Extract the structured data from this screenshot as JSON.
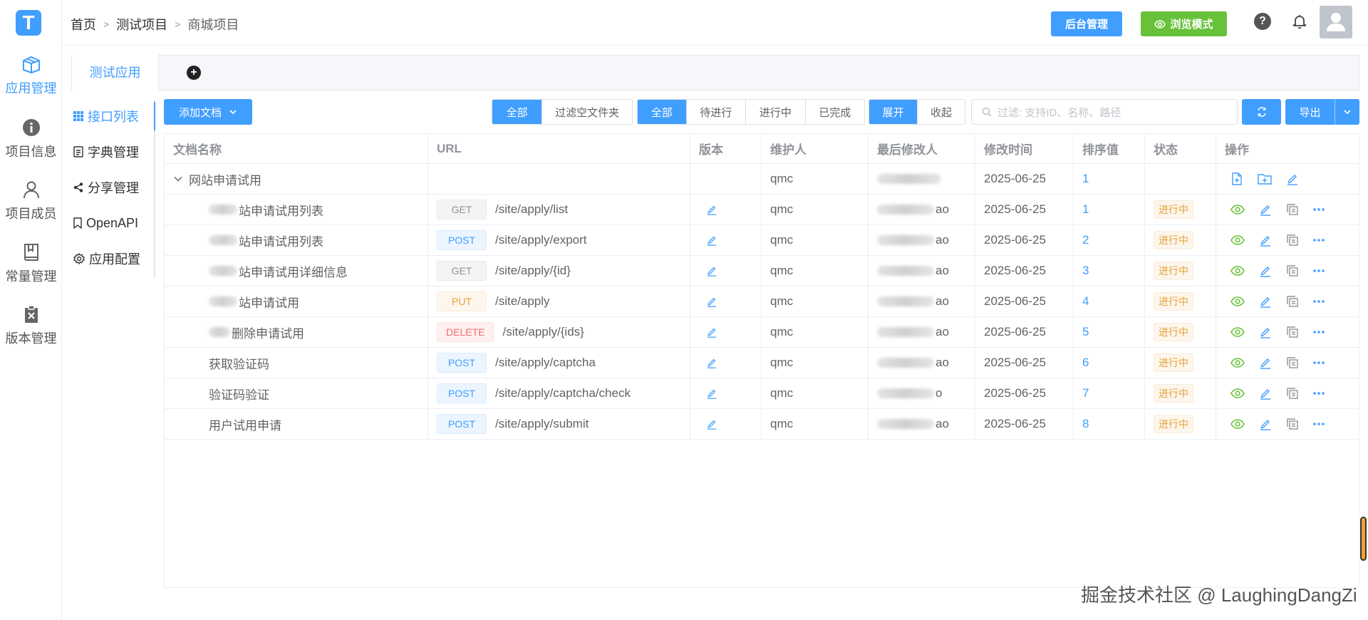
{
  "sidebar": {
    "logo": "T",
    "items": [
      {
        "label": "应用管理",
        "icon": "box-icon",
        "active": true
      },
      {
        "label": "项目信息",
        "icon": "info-icon",
        "active": false
      },
      {
        "label": "项目成员",
        "icon": "user-icon",
        "active": false
      },
      {
        "label": "常量管理",
        "icon": "book-icon",
        "active": false
      },
      {
        "label": "版本管理",
        "icon": "clipboard-x-icon",
        "active": false
      }
    ]
  },
  "header": {
    "breadcrumb": [
      "首页",
      "测试项目",
      "商城项目"
    ],
    "admin_button": "后台管理",
    "browse_button": "浏览模式",
    "help": "?"
  },
  "tabs": {
    "active": "测试应用",
    "add": "+"
  },
  "submenu": [
    {
      "label": "接口列表",
      "icon": "grid-icon",
      "active": true
    },
    {
      "label": "字典管理",
      "icon": "document-icon",
      "active": false
    },
    {
      "label": "分享管理",
      "icon": "share-icon",
      "active": false
    },
    {
      "label": "OpenAPI",
      "icon": "bookmark-icon",
      "active": false
    },
    {
      "label": "应用配置",
      "icon": "settings-icon",
      "active": false
    }
  ],
  "toolbar": {
    "add_doc": "添加文档",
    "filter_group1": [
      "全部",
      "过滤空文件夹"
    ],
    "filter_group2": [
      "全部",
      "待进行",
      "进行中",
      "已完成"
    ],
    "expand_group": [
      "展开",
      "收起"
    ],
    "search_placeholder": "过滤: 支持ID、名称、路径",
    "export": "导出"
  },
  "table": {
    "headers": [
      "文档名称",
      "URL",
      "版本",
      "维护人",
      "最后修改人",
      "修改时间",
      "排序值",
      "状态",
      "操作"
    ],
    "folder": {
      "name": "网站申请试用",
      "maintainer": "qmc",
      "modifier_suffix": "",
      "time": "2025-06-25",
      "order": "1"
    },
    "rows": [
      {
        "name_visible": "站申请试用列表",
        "method": "GET",
        "url": "/site/apply/list",
        "maintainer": "qmc",
        "modifier_suffix": "ao",
        "time": "2025-06-25",
        "order": "1",
        "status": "进行中"
      },
      {
        "name_visible": "站申请试用列表",
        "method": "POST",
        "url": "/site/apply/export",
        "maintainer": "qmc",
        "modifier_suffix": "ao",
        "time": "2025-06-25",
        "order": "2",
        "status": "进行中"
      },
      {
        "name_visible": "站申请试用详细信息",
        "method": "GET",
        "url": "/site/apply/{id}",
        "maintainer": "qmc",
        "modifier_suffix": "ao",
        "time": "2025-06-25",
        "order": "3",
        "status": "进行中"
      },
      {
        "name_visible": "站申请试用",
        "method": "PUT",
        "url": "/site/apply",
        "maintainer": "qmc",
        "modifier_suffix": "ao",
        "time": "2025-06-25",
        "order": "4",
        "status": "进行中"
      },
      {
        "name_visible": "删除申请试用",
        "method": "DELETE",
        "url": "/site/apply/{ids}",
        "maintainer": "qmc",
        "modifier_suffix": "ao",
        "time": "2025-06-25",
        "order": "5",
        "status": "进行中"
      },
      {
        "name_visible": "获取验证码",
        "method": "POST",
        "url": "/site/apply/captcha",
        "maintainer": "qmc",
        "modifier_suffix": "ao",
        "time": "2025-06-25",
        "order": "6",
        "status": "进行中"
      },
      {
        "name_visible": "验证码验证",
        "method": "POST",
        "url": "/site/apply/captcha/check",
        "maintainer": "qmc",
        "modifier_suffix": "o",
        "time": "2025-06-25",
        "order": "7",
        "status": "进行中"
      },
      {
        "name_visible": "用户试用申请",
        "method": "POST",
        "url": "/site/apply/submit",
        "maintainer": "qmc",
        "modifier_suffix": "ao",
        "time": "2025-06-25",
        "order": "8",
        "status": "进行中"
      }
    ]
  },
  "watermark": "掘金技术社区 @ LaughingDangZi",
  "colors": {
    "primary": "#409eff",
    "success": "#67c23a",
    "warning": "#e6a23c",
    "danger": "#f56c6c"
  }
}
